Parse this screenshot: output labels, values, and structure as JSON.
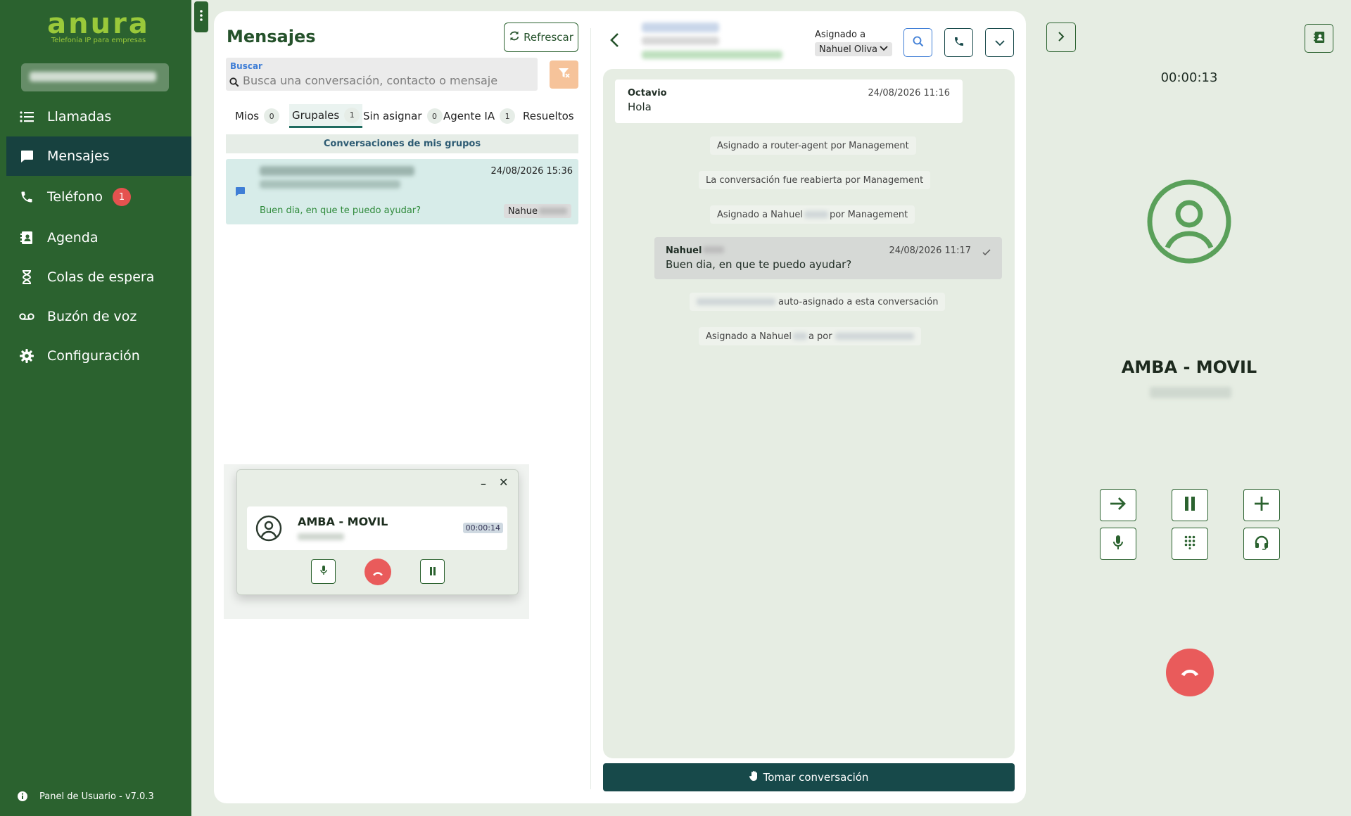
{
  "brand": {
    "logo_text": "anura",
    "tagline": "Telefonía IP para empresas"
  },
  "sidebar": {
    "items": [
      {
        "label": "Llamadas",
        "icon": "list-icon"
      },
      {
        "label": "Mensajes",
        "icon": "chat-icon",
        "active": true
      },
      {
        "label": "Teléfono",
        "icon": "phone-icon",
        "badge": "1"
      },
      {
        "label": "Agenda",
        "icon": "contact-book-icon"
      },
      {
        "label": "Colas de espera",
        "icon": "hourglass-icon"
      },
      {
        "label": "Buzón de voz",
        "icon": "voicemail-icon"
      },
      {
        "label": "Configuración",
        "icon": "gear-icon"
      }
    ],
    "version": "Panel de Usuario - v7.0.3"
  },
  "messages": {
    "title": "Mensajes",
    "refresh_label": "Refrescar",
    "search": {
      "label": "Buscar",
      "placeholder": "Busca una conversación, contacto o mensaje"
    },
    "tabs": [
      {
        "label": "Mios",
        "count": "0"
      },
      {
        "label": "Grupales",
        "count": "1",
        "active": true
      },
      {
        "label": "Sin asignar",
        "count": "0"
      },
      {
        "label": "Agente IA",
        "count": "1"
      },
      {
        "label": "Resueltos"
      }
    ],
    "group_header": "Conversaciones de mis grupos",
    "conversation": {
      "date": "24/08/2026 15:36",
      "preview": "Buen dia, en que te puedo ayudar?",
      "agent": "Nahue"
    }
  },
  "mini_call": {
    "name": "AMBA - MOVIL",
    "timer": "00:00:14",
    "minimize": "–",
    "close": "✕"
  },
  "chat": {
    "assigned_label": "Asignado a",
    "assigned_value": "Nahuel Oliva",
    "incoming": {
      "sender": "Octavio",
      "date": "24/08/2026 11:16",
      "text": "Hola"
    },
    "system": {
      "s1": "Asignado a router-agent por Management",
      "s2": "La conversación fue reabierta por Management",
      "s3_a": "Asignado a Nahuel",
      "s3_b": "por Management",
      "s4": "auto-asignado a esta conversación",
      "s5_a": "Asignado a Nahuel",
      "s5_b": "a por"
    },
    "outgoing": {
      "sender": "Nahuel",
      "date": "24/08/2026 11:17",
      "text": "Buen dia, en que te puedo ayudar?"
    },
    "take_label": "Tomar conversación"
  },
  "phone": {
    "timer": "00:00:13",
    "caller_name": "AMBA - MOVIL"
  },
  "colors": {
    "sidebar": "#2b622f",
    "sidebar_active": "#17413f",
    "accent_green": "#25522b",
    "badge_red": "#e5524f",
    "hangup_red": "#e95b5b",
    "take_button": "#17494a"
  }
}
